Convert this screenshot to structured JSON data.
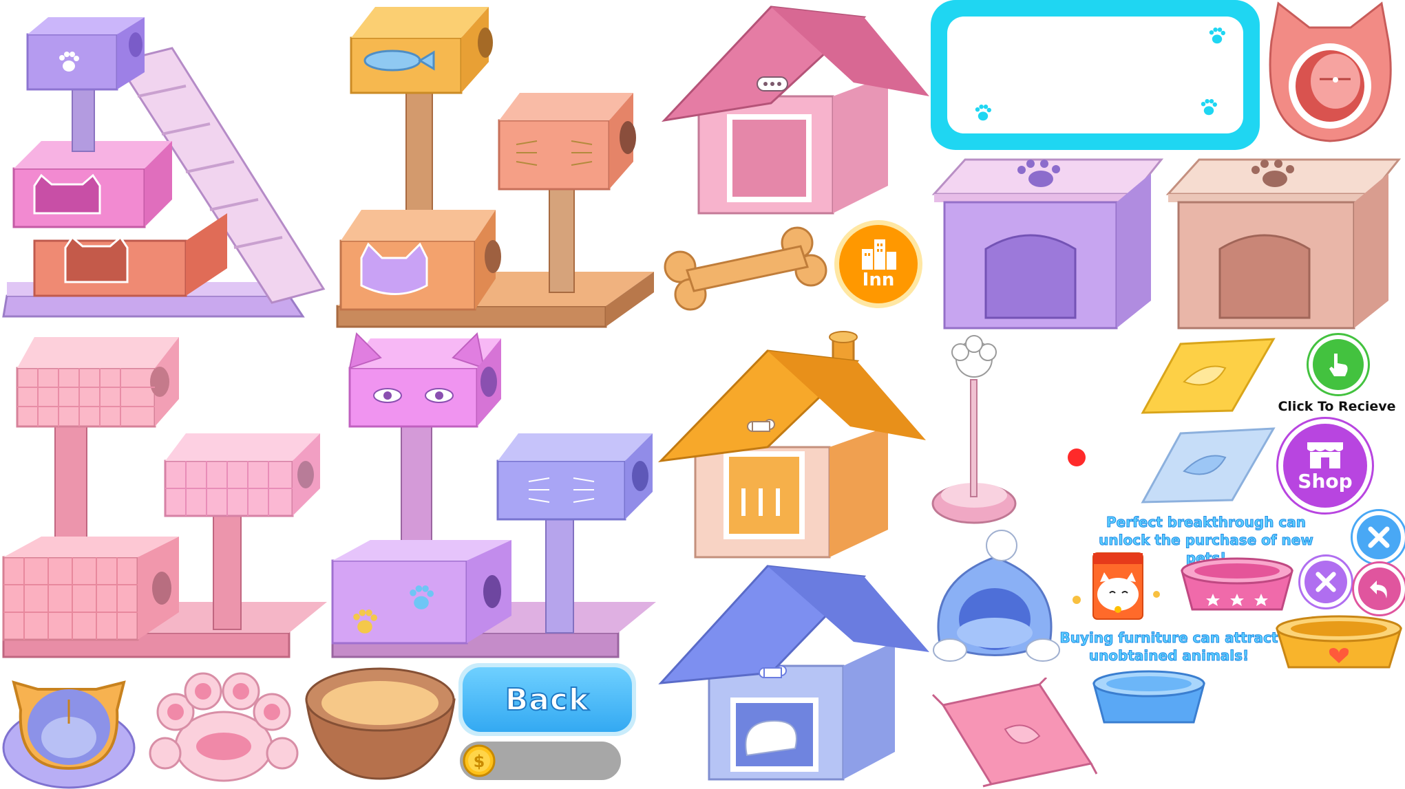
{
  "buttons": {
    "inn_label": "Inn",
    "shop_label": "Shop",
    "back_label": "Back",
    "click_to_receive": "Click To Recieve"
  },
  "tips": {
    "breakthrough_line1": "Perfect breakthrough can",
    "breakthrough_line2": "unlock the purchase of new pets!",
    "furniture_line1": "Buying furniture can attract",
    "furniture_line2": "unobtained animals!"
  },
  "colors": {
    "inn_orange": "#ff9800",
    "shop_purple": "#b845e0",
    "receive_green": "#43c23f",
    "back_blue": "#39aef5",
    "panel_cyan": "#1fd6f2",
    "close_blue": "#49a8f5",
    "close_purple": "#b06ef0",
    "return_pink": "#e0559e"
  },
  "icons": [
    "paw-icon",
    "city-buildings-icon",
    "storefront-icon",
    "pointing-hand-icon",
    "close-x-icon",
    "return-arrow-icon",
    "coin-icon",
    "lucky-cat-icon",
    "bone-icon"
  ]
}
